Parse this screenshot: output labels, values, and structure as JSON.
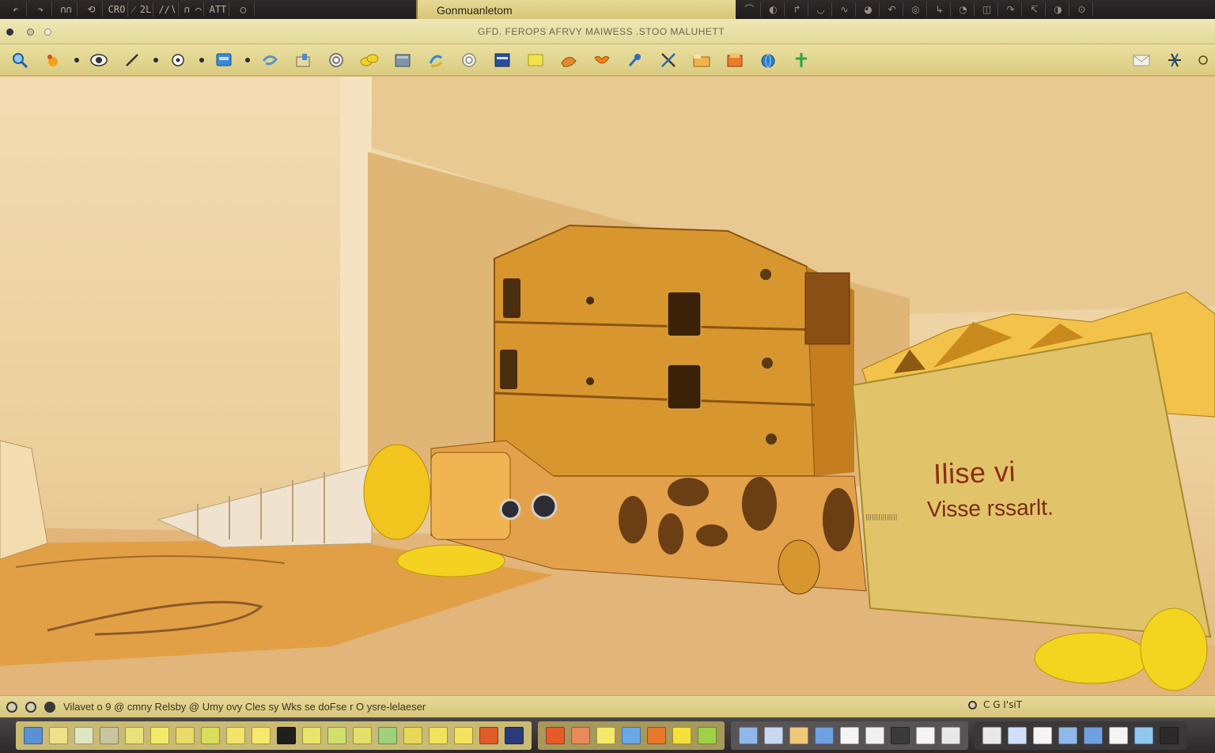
{
  "title_strip": {
    "left_tools": [
      "↶",
      "↷",
      "∩∩",
      "⟲",
      "CRO",
      "⁄ 2L",
      "∕∕∖",
      "∩ ⌒",
      "ATT",
      "◯"
    ],
    "app_tab": "Gonmuanletom",
    "right_tools": [
      "⌒",
      "◐",
      "↱",
      "◡",
      "∿",
      "◕",
      "↶",
      "◎",
      "↳",
      "◔",
      "◫",
      "↷",
      "↸",
      "◑",
      "⊙"
    ]
  },
  "window": {
    "caption": "GFD. FEROPS AFRVY  MAIWESS .STOO  MALUHETT"
  },
  "toolbar": {
    "icons": [
      "search-icon",
      "paint-bucket-icon",
      "eye-icon",
      "pencil-icon",
      "target-icon",
      "screen-icon",
      "lasso-icon",
      "box-icon",
      "spiral-icon",
      "chain-icon",
      "image-icon",
      "rotate-icon",
      "circle-icon",
      "window-icon",
      "note-icon",
      "hand-icon",
      "fire-icon",
      "wrench-icon",
      "tools-icon",
      "folder-icon",
      "stack-icon",
      "globe-icon",
      "pin-icon"
    ],
    "right_icons": [
      "mail-icon",
      "star-icon",
      "circle-small-icon"
    ]
  },
  "canvas": {
    "card_title": "Ilise vi",
    "card_subtitle": "Visse rssarlt.",
    "left_caption": "|||||||||||||||"
  },
  "status_bar": {
    "text": "Vilavet o 9 @ cmny Relsby @ Umy ovy Cles sy Wks se doFse r O ysre-lelaeser",
    "right_text": "C  G I'siT"
  },
  "dock": {
    "group1_count": 20,
    "group2_count": 7,
    "group3_count": 9,
    "group4_count": 8
  },
  "colors": {
    "accent": "#d6c67c",
    "dark_strip": "#2b2829",
    "card_text": "#8d2c14",
    "scene_main": "#d8962e"
  }
}
